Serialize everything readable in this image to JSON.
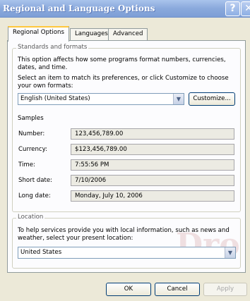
{
  "window": {
    "title": "Regional and Language Options",
    "help_glyph": "?",
    "close_glyph": "✕"
  },
  "tabs": [
    "Regional Options",
    "Languages",
    "Advanced"
  ],
  "standards": {
    "legend": "Standards and formats",
    "description": "This option affects how some programs format numbers, currencies, dates, and time.",
    "instruction": "Select an item to match its preferences, or click Customize to choose your own formats:",
    "selected": "English (United States)",
    "customize_label": "Customize..."
  },
  "samples": {
    "heading": "Samples",
    "rows": [
      {
        "label": "Number:",
        "value": "123,456,789.00"
      },
      {
        "label": "Currency:",
        "value": "$123,456,789.00"
      },
      {
        "label": "Time:",
        "value": "7:55:56 PM"
      },
      {
        "label": "Short date:",
        "value": "7/10/2006"
      },
      {
        "label": "Long date:",
        "value": "Monday, July 10, 2006"
      }
    ]
  },
  "location": {
    "legend": "Location",
    "description": "To help services provide you with local information, such as news and weather, select your present location:",
    "selected": "United States"
  },
  "buttons": {
    "ok": "OK",
    "cancel": "Cancel",
    "apply": "Apply"
  },
  "watermark": "Dro"
}
